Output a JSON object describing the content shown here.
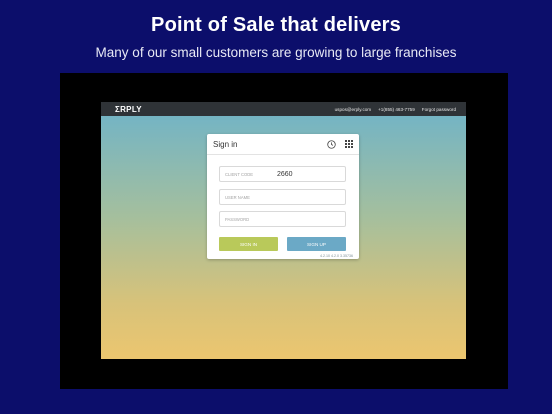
{
  "headline": "Point of Sale that delivers",
  "subheadline": "Many of our small customers are growing to large franchises",
  "app": {
    "logo": "ΣRPLY",
    "email": "uspos@erply.com",
    "phone": "+1(855) 463-7759",
    "forgot_password": "Forgot password"
  },
  "signin": {
    "title": "Sign in",
    "client_code_label": "CLIENT CODE",
    "client_code_value": "2660",
    "username_placeholder": "USER NAME",
    "password_placeholder": "PASSWORD",
    "signin_button": "SIGN IN",
    "signup_button": "SIGN UP",
    "version": "4.2.10  4.2.0  3.35736"
  },
  "icons": [
    "clock-icon",
    "grid-menu-icon"
  ]
}
